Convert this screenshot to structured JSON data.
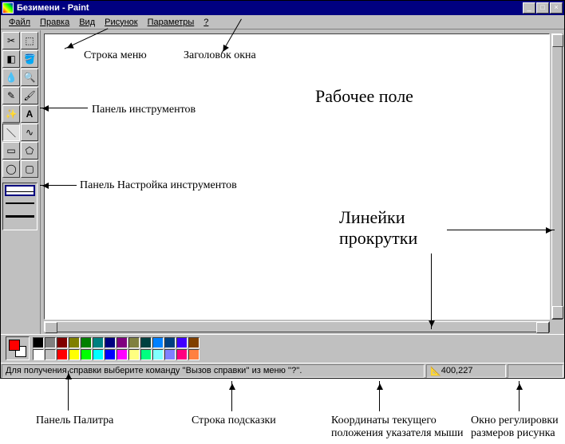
{
  "title": "Безимени - Paint",
  "menu": {
    "file": "Файл",
    "edit": "Правка",
    "view": "Вид",
    "image": "Рисунок",
    "options": "Параметры",
    "help": "?"
  },
  "status": {
    "hint": "Для получения справки выберите команду ''Вызов справки'' из меню ''?''.",
    "coords": "400,227",
    "size": ""
  },
  "palette_top": [
    "#000000",
    "#808080",
    "#800000",
    "#808000",
    "#008000",
    "#008080",
    "#000080",
    "#800080",
    "#808040",
    "#004040",
    "#0080ff",
    "#004080",
    "#4000ff",
    "#804000"
  ],
  "palette_bottom": [
    "#ffffff",
    "#c0c0c0",
    "#ff0000",
    "#ffff00",
    "#00ff00",
    "#00ffff",
    "#0000ff",
    "#ff00ff",
    "#ffff80",
    "#00ff80",
    "#80ffff",
    "#8080ff",
    "#ff0080",
    "#ff8040"
  ],
  "annotations": {
    "menu_line": "Строка меню",
    "title_label": "Заголовок окна",
    "workfield": "Рабочее поле",
    "tool_panel": "Панель инструментов",
    "opts_panel": "Панель Настройка инструментов",
    "scrollbars": "Линейки\nпрокрутки",
    "palette_panel": "Панель Палитра",
    "hint_line": "Строка подсказки",
    "mouse_coords": "Координаты текущего\nположения указателя мыши",
    "size_window": "Окно регулировки\nразмеров рисунка"
  },
  "win_buttons": {
    "min": "_",
    "max": "□",
    "close": "×"
  }
}
